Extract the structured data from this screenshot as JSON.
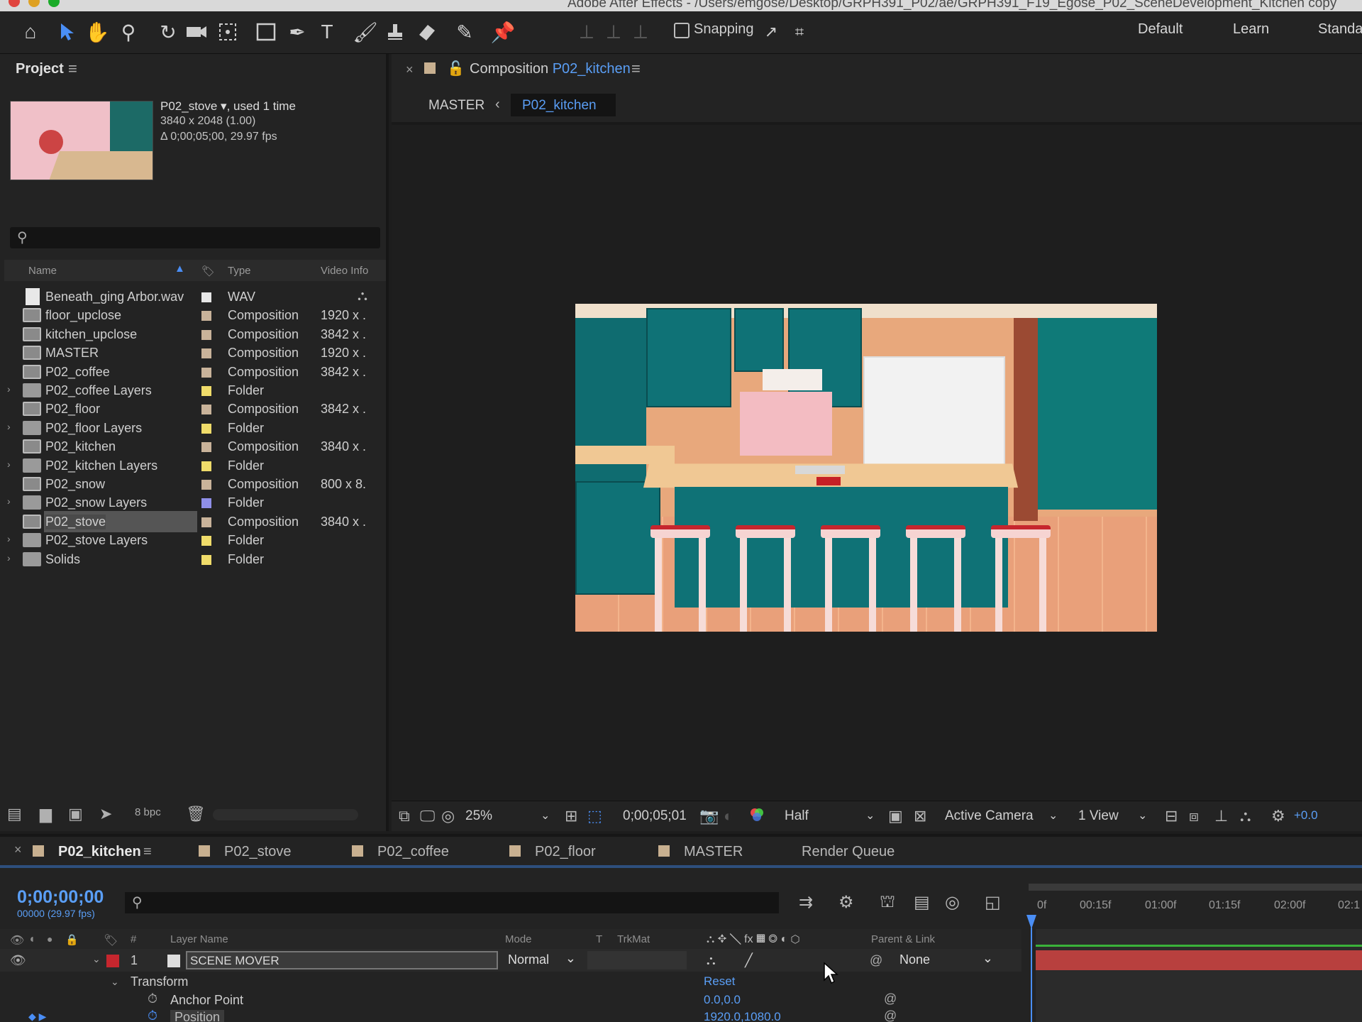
{
  "titlebar": {
    "title": "Adobe After Effects - /Users/emgose/Desktop/GRPH391_P02/ae/GRPH391_F19_Egose_P02_SceneDevelopment_Kitchen copy",
    "dots": [
      "#e0443e",
      "#dea123",
      "#1aab29"
    ]
  },
  "toolbar": {
    "snapping_label": "Snapping",
    "workspaces": [
      "Default",
      "Learn",
      "Standard"
    ],
    "tools": [
      "home-icon",
      "selection-arrow-icon",
      "hand-icon",
      "zoom-icon",
      "rotate-icon",
      "camera-icon",
      "pan-behind-icon",
      "rectangle-icon",
      "pen-icon",
      "type-icon",
      "brush-icon",
      "clone-stamp-icon",
      "eraser-icon",
      "roto-brush-icon",
      "puppet-pin-icon"
    ]
  },
  "project": {
    "title": "Project",
    "selected_name": "P02_stove ▾",
    "selected_used": ", used 1 time",
    "selected_dims": "3840 x 2048 (1.00)",
    "selected_duration": "Δ 0;00;05;00, 29.97 fps",
    "search_placeholder": "",
    "columns": {
      "name": "Name",
      "type": "Type",
      "video_info": "Video Info"
    },
    "bpc": "8 bpc",
    "items": [
      {
        "name": "Beneath_ging Arbor.wav",
        "type": "WAV",
        "info": "",
        "kind": "audio",
        "label": "#e6e6e6",
        "expand": ""
      },
      {
        "name": "floor_upclose",
        "type": "Composition",
        "info": "1920 x .",
        "kind": "comp",
        "label": "#c9b39a",
        "expand": ""
      },
      {
        "name": "kitchen_upclose",
        "type": "Composition",
        "info": "3842 x .",
        "kind": "comp",
        "label": "#c9b39a",
        "expand": ""
      },
      {
        "name": "MASTER",
        "type": "Composition",
        "info": "1920 x .",
        "kind": "comp",
        "label": "#c9b39a",
        "expand": ""
      },
      {
        "name": "P02_coffee",
        "type": "Composition",
        "info": "3842 x .",
        "kind": "comp",
        "label": "#c9b39a",
        "expand": ""
      },
      {
        "name": "P02_coffee Layers",
        "type": "Folder",
        "info": "",
        "kind": "folder",
        "label": "#f0dc6a",
        "expand": "›"
      },
      {
        "name": "P02_floor",
        "type": "Composition",
        "info": "3842 x .",
        "kind": "comp",
        "label": "#c9b39a",
        "expand": ""
      },
      {
        "name": "P02_floor Layers",
        "type": "Folder",
        "info": "",
        "kind": "folder",
        "label": "#f0dc6a",
        "expand": "›"
      },
      {
        "name": "P02_kitchen",
        "type": "Composition",
        "info": "3840 x .",
        "kind": "comp",
        "label": "#c9b39a",
        "expand": ""
      },
      {
        "name": "P02_kitchen Layers",
        "type": "Folder",
        "info": "",
        "kind": "folder",
        "label": "#f0dc6a",
        "expand": "›"
      },
      {
        "name": "P02_snow",
        "type": "Composition",
        "info": "800 x 8.",
        "kind": "comp",
        "label": "#c9b39a",
        "expand": ""
      },
      {
        "name": "P02_snow Layers",
        "type": "Folder",
        "info": "",
        "kind": "folder",
        "label": "#8f8fe8",
        "expand": "›"
      },
      {
        "name": "P02_stove",
        "type": "Composition",
        "info": "3840 x .",
        "kind": "comp",
        "label": "#c9b39a",
        "expand": "",
        "selected": true
      },
      {
        "name": "P02_stove Layers",
        "type": "Folder",
        "info": "",
        "kind": "folder",
        "label": "#f0dc6a",
        "expand": "›"
      },
      {
        "name": "Solids",
        "type": "Folder",
        "info": "",
        "kind": "folder",
        "label": "#f0dc6a",
        "expand": "›"
      }
    ]
  },
  "composition": {
    "tab_prefix": "Composition ",
    "tab_name": "P02_kitchen",
    "crumb_master": "MASTER",
    "crumb_current": "P02_kitchen",
    "zoom": "25%",
    "timecode": "0;00;05;01",
    "resolution": "Half",
    "camera": "Active Camera",
    "views": "1 View",
    "exposure": "+0.0"
  },
  "timeline": {
    "tabs": [
      "P02_kitchen",
      "P02_stove",
      "P02_coffee",
      "P02_floor",
      "MASTER",
      "Render Queue"
    ],
    "timecode": "0;00;00;00",
    "frames": "00000 (29.97 fps)",
    "ruler": [
      "0f",
      "00:15f",
      "01:00f",
      "01:15f",
      "02:00f",
      "02:1"
    ],
    "headers": {
      "layer_name": "Layer Name",
      "mode": "Mode",
      "t": "T",
      "trkmat": "TrkMat",
      "parent": "Parent & Link",
      "hash": "#"
    },
    "layer": {
      "number": "1",
      "name": "SCENE MOVER",
      "mode": "Normal",
      "parent": "None"
    },
    "transform": {
      "label": "Transform",
      "reset": "Reset",
      "anchor_label": "Anchor Point",
      "anchor_value": "0.0,0.0",
      "position_label": "Position",
      "position_value": "1920.0,1080.0"
    }
  }
}
